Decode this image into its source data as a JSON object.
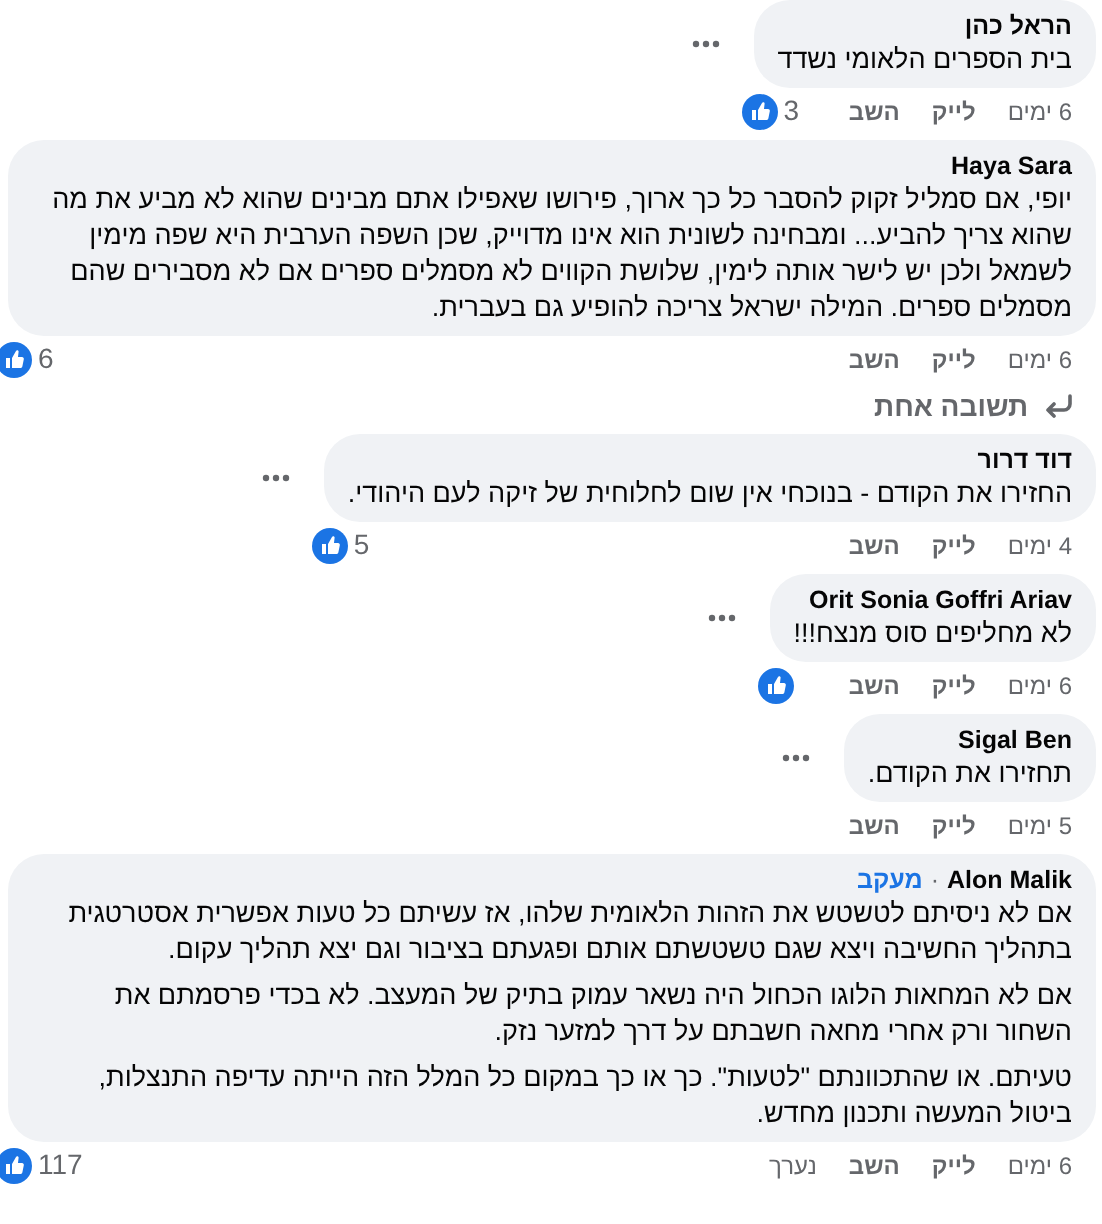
{
  "items": [
    {
      "kind": "comment",
      "author": "הראל כהן",
      "paragraphs": [
        "בית הספרים הלאומי נשדד"
      ],
      "more_menu": true,
      "time": "6 ימים",
      "like": "לייק",
      "reply": "השב",
      "reaction": true,
      "reaction_count": "3"
    },
    {
      "kind": "comment",
      "author": "Haya Sara",
      "paragraphs": [
        "יופי, אם סמליל זקוק להסבר כל כך ארוך, פירושו שאפילו אתם מבינים שהוא לא מביע את מה שהוא צריך להביע... ומבחינה לשונית הוא אינו מדוייק, שכן השפה הערבית היא שפה מימין לשמאל ולכן יש לישר אותה לימין, שלושת הקווים לא מסמלים ספרים אם לא מסבירים שהם מסמלים ספרים. המילה ישראל צריכה להופיע גם בעברית."
      ],
      "more_menu": false,
      "time": "6 ימים",
      "like": "לייק",
      "reply": "השב",
      "reaction": true,
      "reaction_count": "6"
    },
    {
      "kind": "replies_link",
      "label": "תשובה אחת"
    },
    {
      "kind": "comment",
      "author": "דוד דרור",
      "paragraphs": [
        "החזירו את הקודם - בנוכחי אין שום לחלוחית של זיקה לעם היהודי."
      ],
      "more_menu": true,
      "time": "4 ימים",
      "like": "לייק",
      "reply": "השב",
      "reaction": true,
      "reaction_count": "5"
    },
    {
      "kind": "comment",
      "author": "Orit Sonia Goffri Ariav",
      "paragraphs": [
        "לא מחליפים סוס מנצח!!!"
      ],
      "more_menu": true,
      "time": "6 ימים",
      "like": "לייק",
      "reply": "השב",
      "reaction": true
    },
    {
      "kind": "comment",
      "author": "Sigal Ben",
      "paragraphs": [
        "תחזירו את הקודם."
      ],
      "more_menu": true,
      "time": "5 ימים",
      "like": "לייק",
      "reply": "השב",
      "reaction": false
    },
    {
      "kind": "comment",
      "author": "Alon Malik",
      "separator": "·",
      "follow": "מעקב",
      "paragraphs": [
        "אם לא ניסיתם לטשטש את הזהות הלאומית שלהו, אז עשיתם כל טעות אפשרית אסטרטגית בתהליך החשיבה ויצא שגם טשטשתם אותם ופגעתם בציבור וגם יצא תהליך עקום.",
        "אם לא המחאות הלוגו הכחול היה נשאר עמוק בתיק של המעצב. לא בכדי פרסמתם את השחור ורק אחרי מחאה חשבתם על דרך למזער נזק.",
        "טעיתם. או שהתכוונתם \"לטעות\". כך או כך במקום כל המלל הזה הייתה עדיפה התנצלות, ביטול המעשה ותכנון מחדש."
      ],
      "more_menu": false,
      "time": "6 ימים",
      "like": "לייק",
      "reply": "השב",
      "edited": "נערך",
      "reaction": true,
      "reaction_count": "117"
    }
  ]
}
